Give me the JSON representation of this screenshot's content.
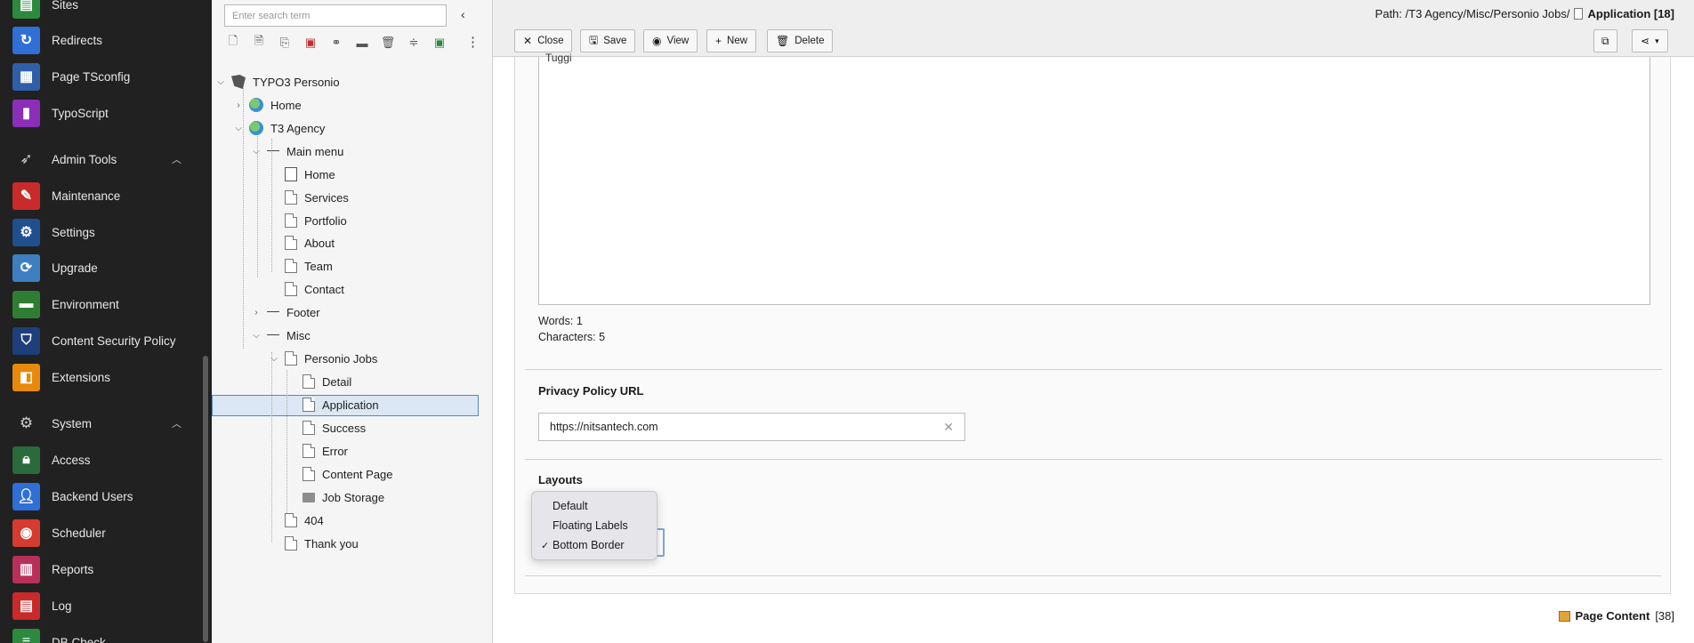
{
  "module_menu": {
    "items": [
      {
        "label": "Sites",
        "icon": "sites-icon",
        "color": "#2b8a3e"
      },
      {
        "label": "Redirects",
        "icon": "redirects-icon",
        "color": "#2f6fd6"
      },
      {
        "label": "Page TSconfig",
        "icon": "page-tsconfig-icon",
        "color": "#2f5fa6"
      },
      {
        "label": "TypoScript",
        "icon": "typoscript-icon",
        "color": "#8b2fb8"
      },
      {
        "label": "Maintenance",
        "icon": "maintenance-icon",
        "color": "#c92a2a"
      },
      {
        "label": "Settings",
        "icon": "settings-icon",
        "color": "#1f4f8f"
      },
      {
        "label": "Upgrade",
        "icon": "upgrade-icon",
        "color": "#3d7fc1"
      },
      {
        "label": "Environment",
        "icon": "environment-icon",
        "color": "#2e7d32"
      },
      {
        "label": "Content Security Policy",
        "icon": "shield-icon",
        "color": "#1e3f7a"
      },
      {
        "label": "Extensions",
        "icon": "extensions-icon",
        "color": "#e8890c"
      },
      {
        "label": "Access",
        "icon": "access-icon",
        "color": "#2b6a3a"
      },
      {
        "label": "Backend Users",
        "icon": "backend-users-icon",
        "color": "#2f6fd6"
      },
      {
        "label": "Scheduler",
        "icon": "scheduler-icon",
        "color": "#d63b2f"
      },
      {
        "label": "Reports",
        "icon": "reports-icon",
        "color": "#b8305a"
      },
      {
        "label": "Log",
        "icon": "log-icon",
        "color": "#c92a2a"
      },
      {
        "label": "DB Check",
        "icon": "db-check-icon",
        "color": "#2b8a3e"
      }
    ],
    "groups": [
      {
        "label": "Admin Tools",
        "icon": "rocket-icon"
      },
      {
        "label": "System",
        "icon": "gear-icon"
      }
    ]
  },
  "page_tree": {
    "search_placeholder": "Enter search term",
    "nodes": [
      {
        "label": "TYPO3 Personio",
        "icon": "typo3"
      },
      {
        "label": "Home",
        "icon": "globe"
      },
      {
        "label": "T3 Agency",
        "icon": "globe"
      },
      {
        "label": "Main menu",
        "icon": "sep"
      },
      {
        "label": "Home",
        "icon": "short"
      },
      {
        "label": "Services",
        "icon": "page"
      },
      {
        "label": "Portfolio",
        "icon": "page"
      },
      {
        "label": "About",
        "icon": "page"
      },
      {
        "label": "Team",
        "icon": "page"
      },
      {
        "label": "Contact",
        "icon": "page"
      },
      {
        "label": "Footer",
        "icon": "sep"
      },
      {
        "label": "Misc",
        "icon": "sep"
      },
      {
        "label": "Personio Jobs",
        "icon": "page"
      },
      {
        "label": "Detail",
        "icon": "page"
      },
      {
        "label": "Application",
        "icon": "page"
      },
      {
        "label": "Success",
        "icon": "page"
      },
      {
        "label": "Error",
        "icon": "page"
      },
      {
        "label": "Content Page",
        "icon": "page"
      },
      {
        "label": "Job Storage",
        "icon": "folder"
      },
      {
        "label": "404",
        "icon": "page"
      },
      {
        "label": "Thank you",
        "icon": "page"
      }
    ]
  },
  "docheader": {
    "path_label": "Path: /T3 Agency/Misc/Personio Jobs/",
    "record_title": "Application [18]",
    "buttons": {
      "close": "Close",
      "save": "Save",
      "view": "View",
      "new": "New",
      "delete": "Delete"
    }
  },
  "form": {
    "textarea_value": "Tuggi",
    "words": "Words: 1",
    "characters": "Characters: 5",
    "privacy_title": "Privacy Policy URL",
    "privacy_value": "https://nitsantech.com",
    "layouts_title": "Layouts",
    "layout_options": [
      "Default",
      "Floating Labels",
      "Bottom Border"
    ],
    "layout_selected": "Bottom Border"
  },
  "footer_link": {
    "label": "Page Content",
    "count": "[38]"
  }
}
